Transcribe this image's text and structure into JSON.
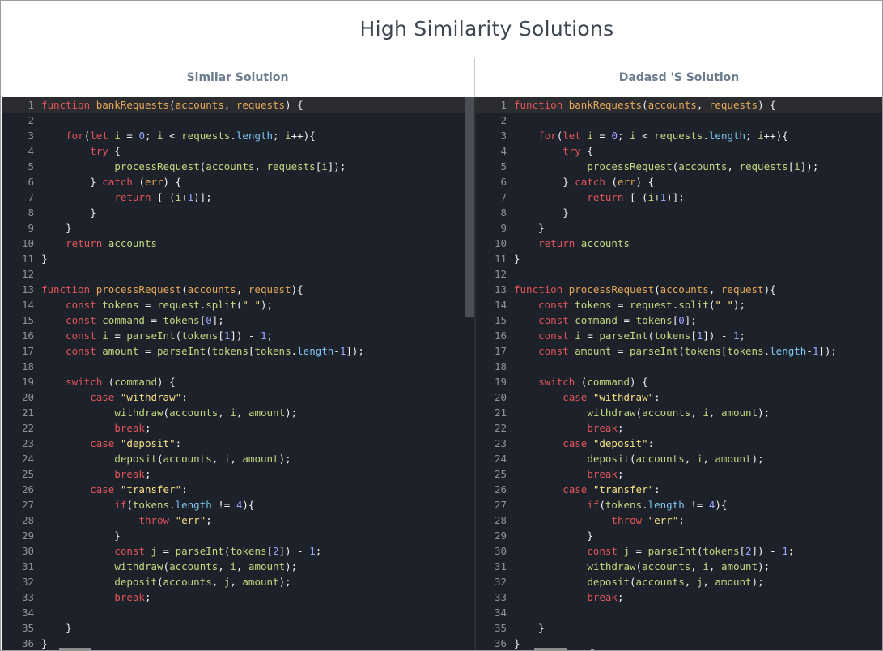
{
  "header": {
    "title": "High Similarity Solutions"
  },
  "columns": [
    {
      "label": "Similar Solution"
    },
    {
      "label": "Dadasd 'S Solution"
    }
  ],
  "code_lines": [
    [
      [
        "k",
        "function "
      ],
      [
        "f",
        "bankRequests"
      ],
      [
        "w",
        "("
      ],
      [
        "p",
        "accounts"
      ],
      [
        "w",
        ", "
      ],
      [
        "p",
        "requests"
      ],
      [
        "w",
        ") {"
      ]
    ],
    [],
    [
      [
        "w",
        "    "
      ],
      [
        "k",
        "for"
      ],
      [
        "w",
        "("
      ],
      [
        "k",
        "let"
      ],
      [
        "w",
        " "
      ],
      [
        "v",
        "i"
      ],
      [
        "w",
        " = "
      ],
      [
        "n",
        "0"
      ],
      [
        "w",
        "; "
      ],
      [
        "v",
        "i"
      ],
      [
        "w",
        " < "
      ],
      [
        "v",
        "requests"
      ],
      [
        "w",
        "."
      ],
      [
        "pr",
        "length"
      ],
      [
        "w",
        "; "
      ],
      [
        "v",
        "i"
      ],
      [
        "w",
        "++){"
      ]
    ],
    [
      [
        "w",
        "        "
      ],
      [
        "k",
        "try"
      ],
      [
        "w",
        " {"
      ]
    ],
    [
      [
        "w",
        "            "
      ],
      [
        "v",
        "processRequest"
      ],
      [
        "w",
        "("
      ],
      [
        "v",
        "accounts"
      ],
      [
        "w",
        ", "
      ],
      [
        "v",
        "requests"
      ],
      [
        "w",
        "["
      ],
      [
        "v",
        "i"
      ],
      [
        "w",
        "]);"
      ]
    ],
    [
      [
        "w",
        "        } "
      ],
      [
        "k",
        "catch"
      ],
      [
        "w",
        " ("
      ],
      [
        "p",
        "err"
      ],
      [
        "w",
        ") {"
      ]
    ],
    [
      [
        "w",
        "            "
      ],
      [
        "k",
        "return"
      ],
      [
        "w",
        " [-("
      ],
      [
        "v",
        "i"
      ],
      [
        "w",
        "+"
      ],
      [
        "n",
        "1"
      ],
      [
        "w",
        ")];"
      ]
    ],
    [
      [
        "w",
        "        }"
      ]
    ],
    [
      [
        "w",
        "    }"
      ]
    ],
    [
      [
        "w",
        "    "
      ],
      [
        "k",
        "return"
      ],
      [
        "w",
        " "
      ],
      [
        "v",
        "accounts"
      ]
    ],
    [
      [
        "w",
        "}"
      ]
    ],
    [],
    [
      [
        "k",
        "function "
      ],
      [
        "f",
        "processRequest"
      ],
      [
        "w",
        "("
      ],
      [
        "p",
        "accounts"
      ],
      [
        "w",
        ", "
      ],
      [
        "p",
        "request"
      ],
      [
        "w",
        "){"
      ]
    ],
    [
      [
        "w",
        "    "
      ],
      [
        "k",
        "const"
      ],
      [
        "w",
        " "
      ],
      [
        "v",
        "tokens"
      ],
      [
        "w",
        " = "
      ],
      [
        "v",
        "request"
      ],
      [
        "w",
        "."
      ],
      [
        "v",
        "split"
      ],
      [
        "w",
        "("
      ],
      [
        "s",
        "\" \""
      ],
      [
        "w",
        ");"
      ]
    ],
    [
      [
        "w",
        "    "
      ],
      [
        "k",
        "const"
      ],
      [
        "w",
        " "
      ],
      [
        "v",
        "command"
      ],
      [
        "w",
        " = "
      ],
      [
        "v",
        "tokens"
      ],
      [
        "w",
        "["
      ],
      [
        "n",
        "0"
      ],
      [
        "w",
        "];"
      ]
    ],
    [
      [
        "w",
        "    "
      ],
      [
        "k",
        "const"
      ],
      [
        "w",
        " "
      ],
      [
        "v",
        "i"
      ],
      [
        "w",
        " = "
      ],
      [
        "v",
        "parseInt"
      ],
      [
        "w",
        "("
      ],
      [
        "v",
        "tokens"
      ],
      [
        "w",
        "["
      ],
      [
        "n",
        "1"
      ],
      [
        "w",
        "]) - "
      ],
      [
        "n",
        "1"
      ],
      [
        "w",
        ";"
      ]
    ],
    [
      [
        "w",
        "    "
      ],
      [
        "k",
        "const"
      ],
      [
        "w",
        " "
      ],
      [
        "v",
        "amount"
      ],
      [
        "w",
        " = "
      ],
      [
        "v",
        "parseInt"
      ],
      [
        "w",
        "("
      ],
      [
        "v",
        "tokens"
      ],
      [
        "w",
        "["
      ],
      [
        "v",
        "tokens"
      ],
      [
        "w",
        "."
      ],
      [
        "pr",
        "length"
      ],
      [
        "w",
        "-"
      ],
      [
        "n",
        "1"
      ],
      [
        "w",
        "]);"
      ]
    ],
    [],
    [
      [
        "w",
        "    "
      ],
      [
        "k",
        "switch"
      ],
      [
        "w",
        " ("
      ],
      [
        "v",
        "command"
      ],
      [
        "w",
        ") {"
      ]
    ],
    [
      [
        "w",
        "        "
      ],
      [
        "k",
        "case"
      ],
      [
        "w",
        " "
      ],
      [
        "s",
        "\"withdraw\""
      ],
      [
        "w",
        ":"
      ]
    ],
    [
      [
        "w",
        "            "
      ],
      [
        "v",
        "withdraw"
      ],
      [
        "w",
        "("
      ],
      [
        "v",
        "accounts"
      ],
      [
        "w",
        ", "
      ],
      [
        "v",
        "i"
      ],
      [
        "w",
        ", "
      ],
      [
        "v",
        "amount"
      ],
      [
        "w",
        ");"
      ]
    ],
    [
      [
        "w",
        "            "
      ],
      [
        "k",
        "break"
      ],
      [
        "w",
        ";"
      ]
    ],
    [
      [
        "w",
        "        "
      ],
      [
        "k",
        "case"
      ],
      [
        "w",
        " "
      ],
      [
        "s",
        "\"deposit\""
      ],
      [
        "w",
        ":"
      ]
    ],
    [
      [
        "w",
        "            "
      ],
      [
        "v",
        "deposit"
      ],
      [
        "w",
        "("
      ],
      [
        "v",
        "accounts"
      ],
      [
        "w",
        ", "
      ],
      [
        "v",
        "i"
      ],
      [
        "w",
        ", "
      ],
      [
        "v",
        "amount"
      ],
      [
        "w",
        ");"
      ]
    ],
    [
      [
        "w",
        "            "
      ],
      [
        "k",
        "break"
      ],
      [
        "w",
        ";"
      ]
    ],
    [
      [
        "w",
        "        "
      ],
      [
        "k",
        "case"
      ],
      [
        "w",
        " "
      ],
      [
        "s",
        "\"transfer\""
      ],
      [
        "w",
        ":"
      ]
    ],
    [
      [
        "w",
        "            "
      ],
      [
        "k",
        "if"
      ],
      [
        "w",
        "("
      ],
      [
        "v",
        "tokens"
      ],
      [
        "w",
        "."
      ],
      [
        "pr",
        "length"
      ],
      [
        "w",
        " != "
      ],
      [
        "n",
        "4"
      ],
      [
        "w",
        "){"
      ]
    ],
    [
      [
        "w",
        "                "
      ],
      [
        "k",
        "throw"
      ],
      [
        "w",
        " "
      ],
      [
        "s",
        "\"err\""
      ],
      [
        "w",
        ";"
      ]
    ],
    [
      [
        "w",
        "            }"
      ]
    ],
    [
      [
        "w",
        "            "
      ],
      [
        "k",
        "const"
      ],
      [
        "w",
        " "
      ],
      [
        "v",
        "j"
      ],
      [
        "w",
        " = "
      ],
      [
        "v",
        "parseInt"
      ],
      [
        "w",
        "("
      ],
      [
        "v",
        "tokens"
      ],
      [
        "w",
        "["
      ],
      [
        "n",
        "2"
      ],
      [
        "w",
        "]) - "
      ],
      [
        "n",
        "1"
      ],
      [
        "w",
        ";"
      ]
    ],
    [
      [
        "w",
        "            "
      ],
      [
        "v",
        "withdraw"
      ],
      [
        "w",
        "("
      ],
      [
        "v",
        "accounts"
      ],
      [
        "w",
        ", "
      ],
      [
        "v",
        "i"
      ],
      [
        "w",
        ", "
      ],
      [
        "v",
        "amount"
      ],
      [
        "w",
        ");"
      ]
    ],
    [
      [
        "w",
        "            "
      ],
      [
        "v",
        "deposit"
      ],
      [
        "w",
        "("
      ],
      [
        "v",
        "accounts"
      ],
      [
        "w",
        ", "
      ],
      [
        "v",
        "j"
      ],
      [
        "w",
        ", "
      ],
      [
        "v",
        "amount"
      ],
      [
        "w",
        ");"
      ]
    ],
    [
      [
        "w",
        "            "
      ],
      [
        "k",
        "break"
      ],
      [
        "w",
        ";"
      ]
    ],
    [],
    [
      [
        "w",
        "    }"
      ]
    ],
    [
      [
        "w",
        "}"
      ]
    ]
  ],
  "colors": {
    "editor_bg": "#1d2129",
    "keyword": "#e0555b",
    "function_name": "#e6a85a",
    "identifier": "#c3d982",
    "number": "#9aa7ff",
    "string": "#f5e088"
  }
}
